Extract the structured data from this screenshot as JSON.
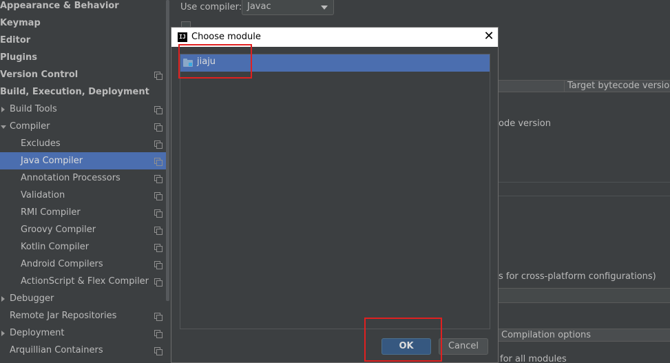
{
  "sidebar": {
    "items": [
      {
        "label": "Appearance & Behavior",
        "bold": true,
        "indent": 0,
        "arrow": "",
        "copy": false,
        "selected": false
      },
      {
        "label": "Keymap",
        "bold": true,
        "indent": 0,
        "arrow": "",
        "copy": false,
        "selected": false
      },
      {
        "label": "Editor",
        "bold": true,
        "indent": 0,
        "arrow": "",
        "copy": false,
        "selected": false
      },
      {
        "label": "Plugins",
        "bold": true,
        "indent": 0,
        "arrow": "",
        "copy": false,
        "selected": false
      },
      {
        "label": "Version Control",
        "bold": true,
        "indent": 0,
        "arrow": "",
        "copy": true,
        "selected": false
      },
      {
        "label": "Build, Execution, Deployment",
        "bold": true,
        "indent": 0,
        "arrow": "",
        "copy": false,
        "selected": false
      },
      {
        "label": "Build Tools",
        "bold": false,
        "indent": 1,
        "arrow": "right",
        "copy": true,
        "selected": false
      },
      {
        "label": "Compiler",
        "bold": false,
        "indent": 1,
        "arrow": "down",
        "copy": true,
        "selected": false
      },
      {
        "label": "Excludes",
        "bold": false,
        "indent": 2,
        "arrow": "",
        "copy": true,
        "selected": false
      },
      {
        "label": "Java Compiler",
        "bold": false,
        "indent": 2,
        "arrow": "",
        "copy": true,
        "selected": true
      },
      {
        "label": "Annotation Processors",
        "bold": false,
        "indent": 2,
        "arrow": "",
        "copy": true,
        "selected": false
      },
      {
        "label": "Validation",
        "bold": false,
        "indent": 2,
        "arrow": "",
        "copy": true,
        "selected": false
      },
      {
        "label": "RMI Compiler",
        "bold": false,
        "indent": 2,
        "arrow": "",
        "copy": true,
        "selected": false
      },
      {
        "label": "Groovy Compiler",
        "bold": false,
        "indent": 2,
        "arrow": "",
        "copy": true,
        "selected": false
      },
      {
        "label": "Kotlin Compiler",
        "bold": false,
        "indent": 2,
        "arrow": "",
        "copy": true,
        "selected": false
      },
      {
        "label": "Android Compilers",
        "bold": false,
        "indent": 2,
        "arrow": "",
        "copy": true,
        "selected": false
      },
      {
        "label": "ActionScript & Flex Compiler",
        "bold": false,
        "indent": 2,
        "arrow": "",
        "copy": true,
        "selected": false
      },
      {
        "label": "Debugger",
        "bold": false,
        "indent": 1,
        "arrow": "right",
        "copy": false,
        "selected": false
      },
      {
        "label": "Remote Jar Repositories",
        "bold": false,
        "indent": 1,
        "arrow": "",
        "copy": true,
        "selected": false
      },
      {
        "label": "Deployment",
        "bold": false,
        "indent": 1,
        "arrow": "right",
        "copy": true,
        "selected": false
      },
      {
        "label": "Arquillian Containers",
        "bold": false,
        "indent": 1,
        "arrow": "",
        "copy": true,
        "selected": false
      }
    ]
  },
  "main": {
    "use_compiler_label": "Use compiler:",
    "compiler_value": "Javac",
    "target_bytecode_header": "Target bytecode version",
    "bytecode_version_text": "ode version",
    "cross_platform_text": "s for cross-platform configurations)",
    "compilation_options_header": "Compilation options",
    "all_modules_text": "for all modules"
  },
  "dialog": {
    "title": "Choose module",
    "logo_text": "IJ",
    "close_glyph": "✕",
    "modules": [
      {
        "name": "jiaju",
        "selected": true
      }
    ],
    "ok_label": "OK",
    "cancel_label": "Cancel"
  },
  "colors": {
    "background": "#3c3f41",
    "selection": "#4b6eaf",
    "ok_button": "#365880",
    "annotation": "#e02020"
  }
}
